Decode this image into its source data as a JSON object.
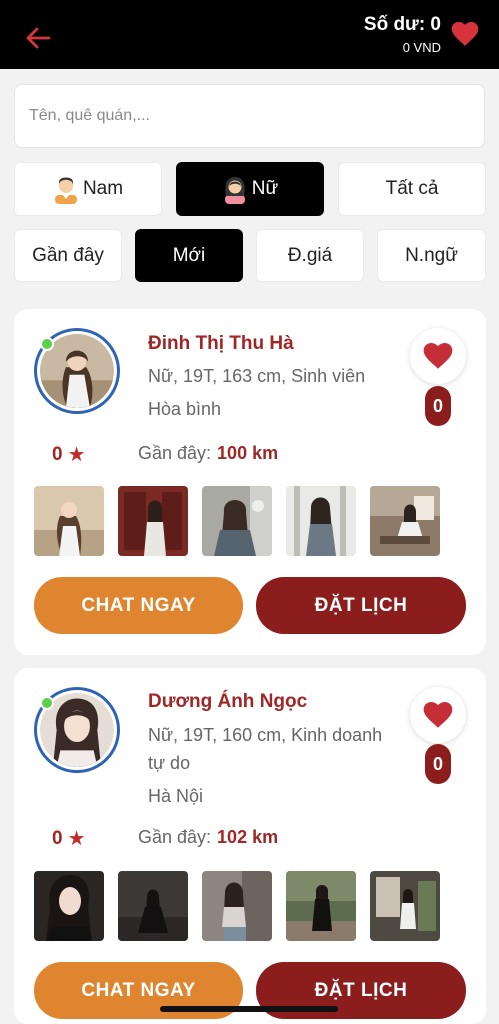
{
  "header": {
    "balance_label": "Số dư: 0",
    "balance_unit": "0 VND"
  },
  "search": {
    "placeholder": "Tên, quê quán,..."
  },
  "gender_filters": [
    {
      "label": "Nam",
      "icon": "male-avatar-icon",
      "active": false
    },
    {
      "label": "Nữ",
      "icon": "female-avatar-icon",
      "active": true
    },
    {
      "label": "Tất cả",
      "active": false
    }
  ],
  "sort_filters": [
    {
      "label": "Gần đây",
      "active": false
    },
    {
      "label": "Mới",
      "active": true
    },
    {
      "label": "Đ.giá",
      "active": false
    },
    {
      "label": "N.ngữ",
      "active": false
    }
  ],
  "profiles": [
    {
      "name": "Đinh Thị Thu Hà",
      "details": "Nữ, 19T, 163 cm, Sinh viên",
      "hometown": "Hòa bình",
      "likes": "0",
      "rating": "0",
      "distance_label": "Gần đây:",
      "distance_value": "100 km",
      "online": true
    },
    {
      "name": "Dương Ánh Ngọc",
      "details": "Nữ, 19T, 160 cm, Kinh doanh tự do",
      "hometown": "Hà Nội",
      "likes": "0",
      "rating": "0",
      "distance_label": "Gần đây:",
      "distance_value": "102 km",
      "online": true
    }
  ],
  "actions": {
    "chat_label": "CHAT NGAY",
    "book_label": "ĐẶT LỊCH"
  },
  "colors": {
    "header_bg": "#000000",
    "accent_red": "#8b1d1d",
    "name_red": "#a12626",
    "chat_orange": "#e0852f",
    "online_green": "#5ad04a",
    "avatar_ring": "#2f63b5"
  }
}
